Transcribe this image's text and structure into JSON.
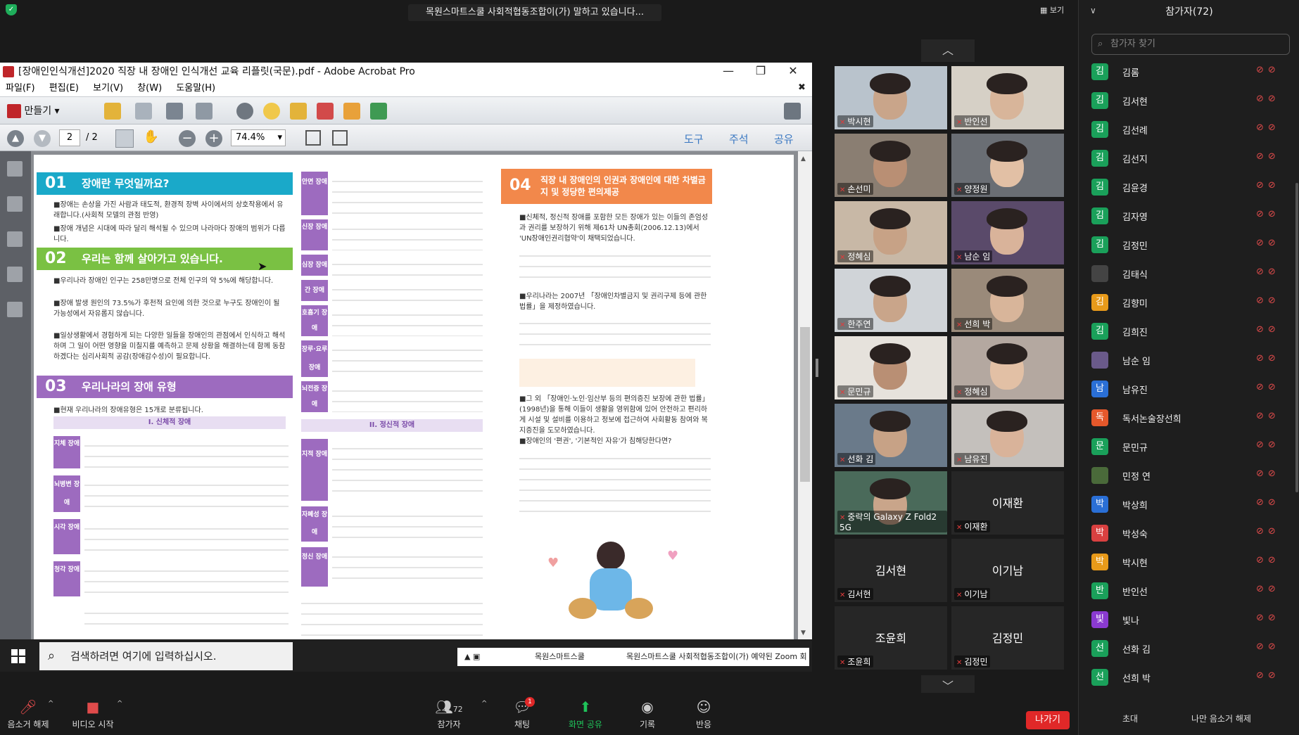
{
  "meeting": {
    "speaking": "목원스마트스쿨 사회적협동조합이(가) 말하고 있습니다...",
    "view_label": "보기"
  },
  "acrobat": {
    "title": "[장애인인식개선]2020 직장 내 장애인 인식개선 교육 리플릿(국문).pdf - Adobe Acrobat Pro",
    "menu": [
      "파일(F)",
      "편집(E)",
      "보기(V)",
      "창(W)",
      "도움말(H)"
    ],
    "create_label": "만들기",
    "page_current": "2",
    "page_total": "/ 2",
    "zoom": "74.4%",
    "right_tools": [
      "도구",
      "주석",
      "공유"
    ]
  },
  "pdf": {
    "sec1_num": "01",
    "sec1_title": "장애란 무엇일까요?",
    "sec1_text1": "■장애는 손상을 가진 사람과 태도적, 환경적 장벽 사이에서의 상호작용에서 유래합니다.(사회적 모델의 관점 반영)",
    "sec1_text2": "■장애 개념은 시대에 따라 달리 해석될 수 있으며 나라마다 장애의 범위가 다릅니다.",
    "sec2_num": "02",
    "sec2_title": "우리는 함께 살아가고 있습니다.",
    "sec2_text1": "■우리나라 장애인 인구는 258만명으로 전체 인구의 약 5%에 해당합니다.",
    "sec2_text2": "■장애 발생 원인의 73.5%가 후천적 요인에 의한 것으로 누구도 장애인이 될 가능성에서 자유롭지 않습니다.",
    "sec2_text3": "■일상생활에서 경험하게 되는 다양한 일들을 장애인의 관점에서 인식하고 해석하며 그 일이 어떤 영향을 미칠지를 예측하고 문제 상황을 해결하는데 함께 동참하겠다는 심리사회적 공감(장애감수성)이 필요합니다.",
    "sec3_num": "03",
    "sec3_title": "우리나라의 장애 유형",
    "sec3_text1": "■현재 우리나라의 장애유형은 15개로 분류됩니다.",
    "phys_header": "I. 신체적 장애",
    "phys_labels": [
      "지체 장애",
      "뇌병변 장애",
      "시각 장애",
      "청각 장애"
    ],
    "mid_labels": [
      "안면 장애",
      "신장 장애",
      "심장 장애",
      "간 장애",
      "호흡기 장애",
      "장루·요루장애",
      "뇌전증 장애"
    ],
    "mental_header": "II. 정신적 장애",
    "mental_labels": [
      "지적 장애",
      "자폐성 장애",
      "정신 장애"
    ],
    "sec4_num": "04",
    "sec4_title": "직장 내 장애인의 인권과 장애인에 대한 차별금지 및 정당한 편의제공",
    "sec4_text1": "■신체적, 정신적 장애를 포함한 모든 장애가 있는 이들의 존엄성과 권리를 보장하기 위해 제61차 UN총회(2006.12.13)에서 'UN장애인권리협약'이 채택되었습니다.",
    "sec4_text2": "■우리나라는 2007년 「장애인차별금지 및 권리구제 등에 관한 법률」을 제정하였습니다.",
    "sec4_text3": "■그 외 「장애인·노인·임산부 등의 편의증진 보장에 관한 법률」(1998년)을 통해 이들이 생활을 영위함에 있어 안전하고 편리하게 시설 및 설비를 이용하고 정보에 접근하여 사회활동 참여와 복지증진을 도모하였습니다.",
    "sec4_text4": "■장애인의 '편권', '기본적인 자유'가 침해당한다면?"
  },
  "taskbar": {
    "search_placeholder": "검색하려면 여기에 입력하십시오.",
    "window_label": "목원스마트스쿨",
    "window_label2": "목원스마트스쿨 사회적협동조합이(가) 예약된 Zoom 회"
  },
  "videos": [
    {
      "name": "박시현"
    },
    {
      "name": "반인선"
    },
    {
      "name": "손선미"
    },
    {
      "name": "양정원"
    },
    {
      "name": "정혜심"
    },
    {
      "name": "남순 임"
    },
    {
      "name": "한주연"
    },
    {
      "name": "선희 박"
    },
    {
      "name": "문민규"
    },
    {
      "name": "정혜심"
    },
    {
      "name": "선화 김"
    },
    {
      "name": "남유진"
    },
    {
      "name": "중락의 Galaxy Z Fold2 5G"
    },
    {
      "name": "이재환",
      "big": "이재환"
    },
    {
      "name": "김서현",
      "big": "김서현"
    },
    {
      "name": "이기남",
      "big": "이기남"
    },
    {
      "name": "조윤희",
      "big": "조윤희"
    },
    {
      "name": "김정민",
      "big": "김정민"
    }
  ],
  "participants_panel": {
    "title": "참가자(72)",
    "search_placeholder": "참가자 찾기",
    "invite": "초대",
    "unmute_me": "나만 음소거 해제",
    "list": [
      {
        "initial": "김",
        "name": "김롬",
        "color": "#1aa05a"
      },
      {
        "initial": "김",
        "name": "김서현",
        "color": "#1aa05a"
      },
      {
        "initial": "김",
        "name": "김선례",
        "color": "#1aa05a"
      },
      {
        "initial": "김",
        "name": "김선지",
        "color": "#1aa05a"
      },
      {
        "initial": "김",
        "name": "김윤경",
        "color": "#1aa05a"
      },
      {
        "initial": "김",
        "name": "김자영",
        "color": "#1aa05a"
      },
      {
        "initial": "김",
        "name": "김정민",
        "color": "#1aa05a"
      },
      {
        "initial": "",
        "name": "김태식",
        "color": "#444444"
      },
      {
        "initial": "김",
        "name": "김향미",
        "color": "#e89a1a"
      },
      {
        "initial": "김",
        "name": "김희진",
        "color": "#1aa05a"
      },
      {
        "initial": "",
        "name": "남순 임",
        "color": "#6a5a8a"
      },
      {
        "initial": "남",
        "name": "남유진",
        "color": "#2a6fd6"
      },
      {
        "initial": "독",
        "name": "독서논술장선희",
        "color": "#e5582b"
      },
      {
        "initial": "문",
        "name": "문민규",
        "color": "#1aa05a"
      },
      {
        "initial": "",
        "name": "민정 연",
        "color": "#4a6a3a"
      },
      {
        "initial": "박",
        "name": "박상희",
        "color": "#2a6fd6"
      },
      {
        "initial": "박",
        "name": "박성숙",
        "color": "#d94040"
      },
      {
        "initial": "박",
        "name": "박시현",
        "color": "#e89a1a"
      },
      {
        "initial": "반",
        "name": "반인선",
        "color": "#1aa05a"
      },
      {
        "initial": "빛",
        "name": "빛나",
        "color": "#8a3ad0"
      },
      {
        "initial": "선",
        "name": "선화 김",
        "color": "#1aa05a"
      },
      {
        "initial": "선",
        "name": "선희 박",
        "color": "#1aa05a"
      }
    ]
  },
  "toolbar": {
    "unmute": "음소거 해제",
    "video": "비디오 시작",
    "participants": "참가자",
    "participants_count": "72",
    "chat": "채팅",
    "chat_badge": "1",
    "share": "화면 공유",
    "record": "기록",
    "reactions": "반응",
    "leave": "나가기"
  },
  "colors": {
    "accent_green": "#1fae5b",
    "leave_red": "#e02828",
    "pdf_cyan": "#1aa9c9",
    "pdf_green": "#7ac143",
    "pdf_purple": "#9d6bbf",
    "pdf_orange": "#f2884b"
  }
}
